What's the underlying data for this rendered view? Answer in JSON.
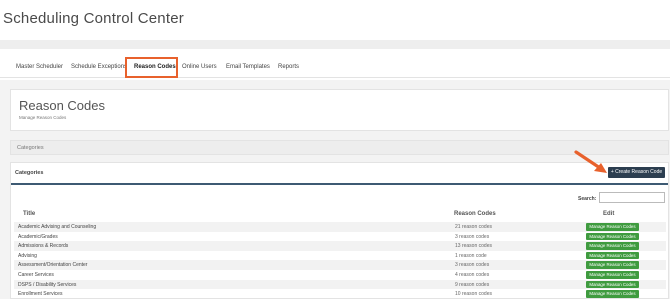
{
  "app": {
    "title": "Scheduling Control Center"
  },
  "tabs": [
    {
      "label": "Master Scheduler"
    },
    {
      "label": "Schedule Exceptions"
    },
    {
      "label": "Reason Codes",
      "active": true
    },
    {
      "label": "Online Users"
    },
    {
      "label": "Email Templates"
    },
    {
      "label": "Reports"
    }
  ],
  "header": {
    "title": "Reason Codes",
    "subtitle": "Manage Reason Codes"
  },
  "categories_bar": {
    "label": "Categories"
  },
  "panel": {
    "title": "Categories",
    "create_label": "+ Create Reason Code",
    "search_label": "Search:",
    "search_value": ""
  },
  "table": {
    "columns": [
      "Title",
      "Reason Codes",
      "Edit"
    ],
    "manage_label": "Manage Reason Codes",
    "rows": [
      {
        "title": "Academic Advising and Counseling",
        "count": "21 reason codes"
      },
      {
        "title": "Academic/Grades",
        "count": "3 reason codes"
      },
      {
        "title": "Admissions & Records",
        "count": "13 reason codes"
      },
      {
        "title": "Advising",
        "count": "1 reason code"
      },
      {
        "title": "Assessment/Orientation Center",
        "count": "3 reason codes"
      },
      {
        "title": "Career Services",
        "count": "4 reason codes"
      },
      {
        "title": "DSPS / Disability Services",
        "count": "9 reason codes"
      },
      {
        "title": "Enrollment Services",
        "count": "10 reason codes"
      }
    ]
  },
  "colors": {
    "highlight": "#e8612c",
    "create_button": "#2c3e50",
    "manage_button": "#3f9b3f",
    "panel_rule": "#3d5a73"
  },
  "annotation": {
    "arrow_icon": "orange-arrow-icon"
  }
}
